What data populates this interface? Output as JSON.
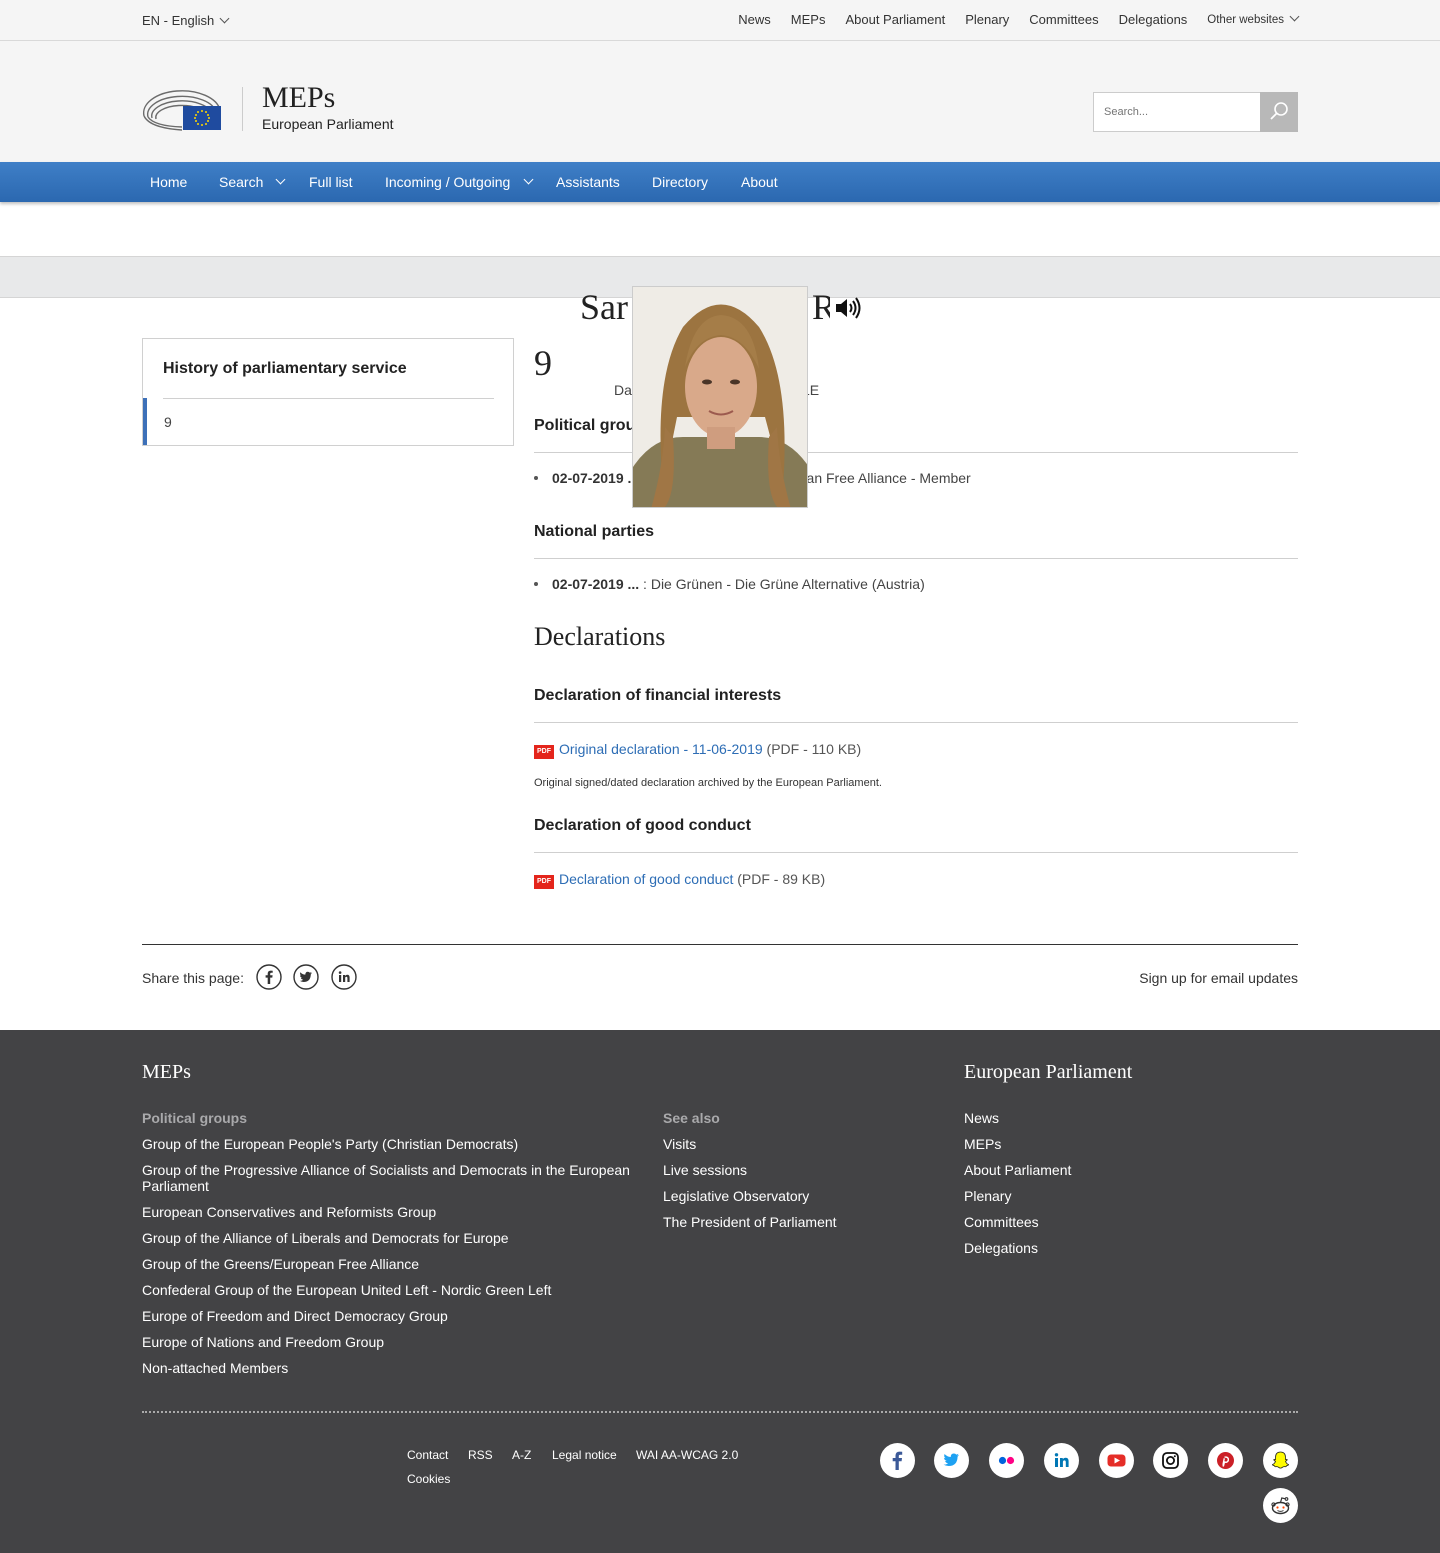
{
  "topbar": {
    "language": "EN - English",
    "links": [
      "News",
      "MEPs",
      "About Parliament",
      "Plenary",
      "Committees",
      "Delegations"
    ],
    "other_websites": "Other websites"
  },
  "header": {
    "title": "MEPs",
    "subtitle": "European Parliament",
    "search_placeholder": "Search..."
  },
  "nav": {
    "home": "Home",
    "search": "Search",
    "full_list": "Full list",
    "incoming_outgoing": "Incoming / Outgoing",
    "assistants": "Assistants",
    "directory": "Directory",
    "about": "About"
  },
  "profile": {
    "name_visible": "Sar",
    "name_visible_end": "R",
    "term": "9",
    "dob_start": "Da",
    "dob_end": "LE"
  },
  "sidebar": {
    "title": "History of parliamentary service",
    "item": "9"
  },
  "political_groups": {
    "heading": "Political grou",
    "date": "02-07-2019 ...",
    "text": "opean Free Alliance - Member"
  },
  "national_parties": {
    "heading": "National parties",
    "date": "02-07-2019 ...",
    "text": " : Die Grünen - Die Grüne Alternative (Austria)"
  },
  "declarations": {
    "heading": "Declarations",
    "financial": {
      "heading": "Declaration of financial interests",
      "pdf_badge": "PDF",
      "link": "Original declaration - 11-06-2019",
      "meta": " (PDF - 110 KB)",
      "note": "Original signed/dated declaration archived by the European Parliament."
    },
    "conduct": {
      "heading": "Declaration of good conduct",
      "pdf_badge": "PDF",
      "link": "Declaration of good conduct",
      "meta": " (PDF - 89 KB)"
    }
  },
  "share": {
    "label": "Share this page:",
    "signup": "Sign up for email updates"
  },
  "footer": {
    "col1_title": "MEPs",
    "groups_heading": "Political groups",
    "groups": [
      "Group of the European People's Party (Christian Democrats)",
      "Group of the Progressive Alliance of Socialists and Democrats in the European Parliament",
      "European Conservatives and Reformists Group",
      "Group of the Alliance of Liberals and Democrats for Europe",
      "Group of the Greens/European Free Alliance",
      "Confederal Group of the European United Left - Nordic Green Left",
      "Europe of Freedom and Direct Democracy Group",
      "Europe of Nations and Freedom Group",
      "Non-attached Members"
    ],
    "see_also_heading": "See also",
    "see_also": [
      "Visits",
      "Live sessions",
      "Legislative Observatory",
      "The President of Parliament"
    ],
    "col3_title": "European Parliament",
    "ep_links": [
      "News",
      "MEPs",
      "About Parliament",
      "Plenary",
      "Committees",
      "Delegations"
    ],
    "bottom_links": [
      "Contact",
      "RSS",
      "A-Z",
      "Legal notice",
      "WAI AA-WCAG 2.0",
      "Cookies"
    ]
  },
  "colors": {
    "nav_blue": "#2b68b0",
    "link_blue": "#2d6db5",
    "footer_bg": "#434345",
    "pdf_red": "#e4251b"
  },
  "icons": [
    "ep-logo-icon",
    "search-icon",
    "speaker-icon",
    "facebook-icon",
    "twitter-icon",
    "linkedin-icon",
    "flickr-icon",
    "youtube-icon",
    "instagram-icon",
    "pinterest-icon",
    "snapchat-icon",
    "reddit-icon"
  ]
}
